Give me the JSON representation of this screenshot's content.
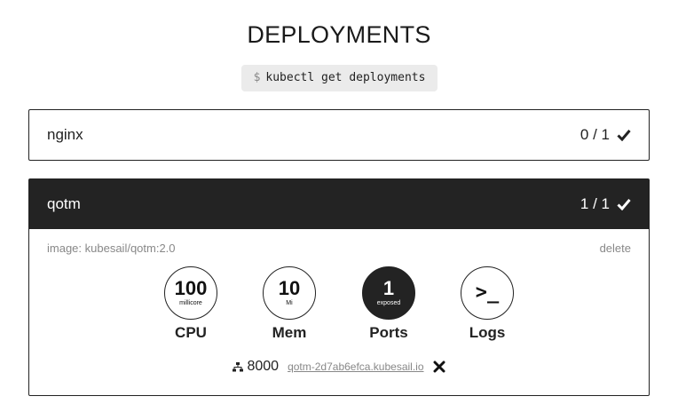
{
  "page": {
    "title": "DEPLOYMENTS",
    "command_prompt": "$",
    "command": "kubectl get deployments"
  },
  "deployments": [
    {
      "name": "nginx",
      "replicas": "0 / 1",
      "status_icon": "check-icon",
      "expanded": false
    },
    {
      "name": "qotm",
      "replicas": "1 / 1",
      "status_icon": "check-icon",
      "expanded": true,
      "image": "image: kubesail/qotm:2.0",
      "delete_label": "delete",
      "metrics": {
        "cpu": {
          "value": "100",
          "unit": "millicore",
          "label": "CPU"
        },
        "mem": {
          "value": "10",
          "unit": "Mi",
          "label": "Mem"
        },
        "ports": {
          "value": "1",
          "unit": "exposed",
          "label": "Ports"
        },
        "logs": {
          "glyph": ">_",
          "label": "Logs"
        }
      },
      "port": {
        "number": "8000",
        "url": "qotm-2d7ab6efca.kubesail.io",
        "icon": "network-icon"
      }
    }
  ],
  "colors": {
    "dark": "#232323",
    "muted": "#888888",
    "command_bg": "#ebebeb"
  }
}
